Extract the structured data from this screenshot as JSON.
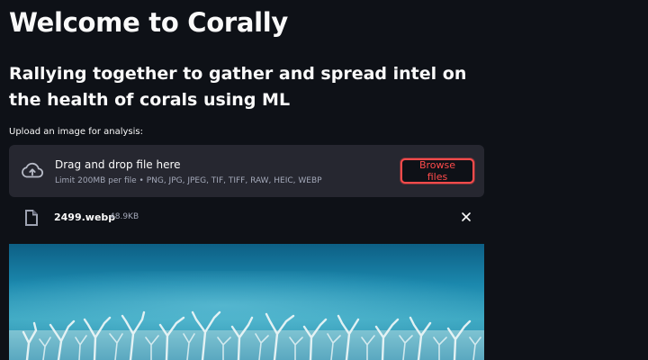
{
  "page": {
    "title": "Welcome to Corally",
    "subtitle": "Rallying together to gather and spread intel on the health of corals using ML"
  },
  "uploader": {
    "label": "Upload an image for analysis:",
    "dropzone_title": "Drag and drop file here",
    "limit_text": "Limit 200MB per file • PNG, JPG, JPEG, TIF, TIFF, RAW, HEIC, WEBP",
    "browse_label": "Browse files",
    "cloud_icon": "cloud-upload-icon"
  },
  "uploaded_file": {
    "name": "2499.webp",
    "size": "48.9KB",
    "file_icon": "file-icon",
    "remove_icon": "close-icon"
  },
  "colors": {
    "background": "#0e1117",
    "dropzone": "#262730",
    "accent": "#ff4b4b",
    "muted_text": "#a3a8b8"
  }
}
